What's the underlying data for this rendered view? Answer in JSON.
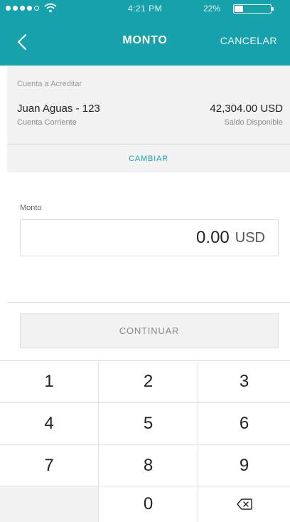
{
  "status": {
    "time": "4:21 PM",
    "battery": "22%"
  },
  "nav": {
    "title": "MONTO",
    "cancel_label": "CANCELAR",
    "back_icon": "chevron-left-icon"
  },
  "account": {
    "caption": "Cuenta a Acreditar",
    "name": "Juan Aguas - 123",
    "type": "Cuenta Corriente",
    "balance": "42,304.00 USD",
    "balance_label": "Saldo Disponible",
    "change_label": "CAMBIAR"
  },
  "amount": {
    "label": "Monto",
    "value": "0.00",
    "currency": "USD"
  },
  "continue_label": "CONTINUAR",
  "keypad": {
    "keys": [
      "1",
      "2",
      "3",
      "4",
      "5",
      "6",
      "7",
      "8",
      "9",
      "",
      "0",
      "backspace"
    ]
  },
  "colors": {
    "accent": "#17a2ab",
    "panel": "#f2f2f2"
  }
}
